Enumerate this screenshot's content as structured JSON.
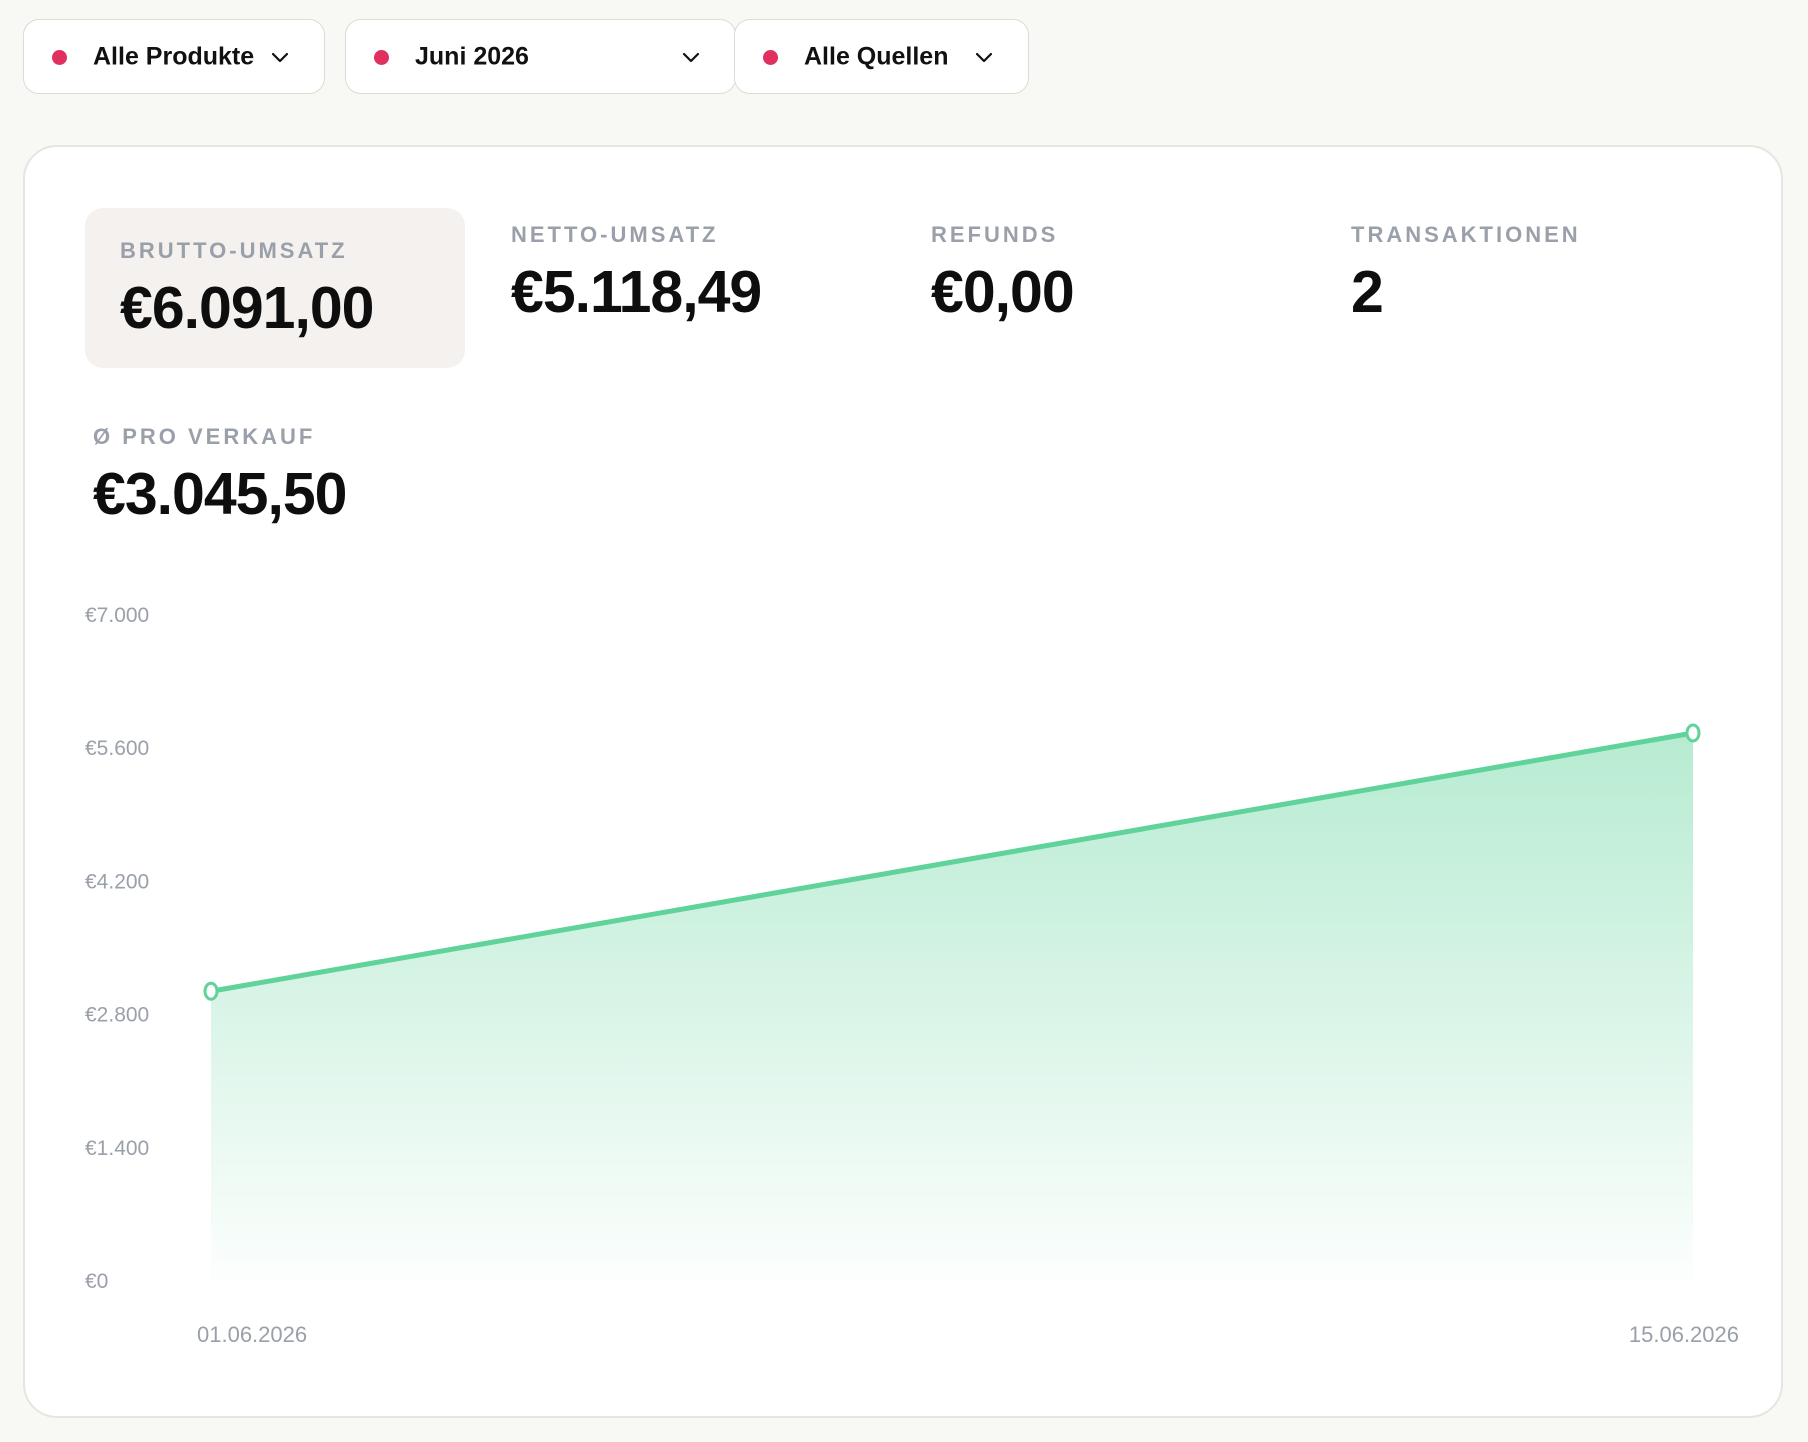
{
  "filters": [
    {
      "label": "Alle Produkte",
      "dot_color": "#e0305f"
    },
    {
      "label": "Juni 2026",
      "dot_color": "#e0305f"
    },
    {
      "label": "Alle Quellen",
      "dot_color": "#e0305f"
    }
  ],
  "stats": {
    "brutto": {
      "label": "BRUTTO-UMSATZ",
      "value": "€6.091,00"
    },
    "netto": {
      "label": "NETTO-UMSATZ",
      "value": "€5.118,49"
    },
    "refunds": {
      "label": "REFUNDS",
      "value": "€0,00"
    },
    "transaktionen": {
      "label": "TRANSAKTIONEN",
      "value": "2"
    },
    "pro_verkauf": {
      "label": "Ø PRO VERKAUF",
      "value": "€3.045,50"
    }
  },
  "colors": {
    "accent_line": "#5fd39a",
    "filter_dot": "#e0305f",
    "muted_text": "#9aa0aa"
  },
  "chart_data": {
    "type": "area",
    "x": [
      "01.06.2026",
      "15.06.2026"
    ],
    "y_values": [
      3045.5,
      5760
    ],
    "y_ticks": [
      "€7.000",
      "€5.600",
      "€4.200",
      "€2.800",
      "€1.400",
      "€0"
    ],
    "y_tick_values": [
      7000,
      5600,
      4200,
      2800,
      1400,
      0
    ],
    "x_tick_labels": [
      "01.06.2026",
      "15.06.2026"
    ],
    "ylim": [
      0,
      7000
    ],
    "grid": false,
    "title": "",
    "xlabel": "",
    "ylabel": ""
  }
}
